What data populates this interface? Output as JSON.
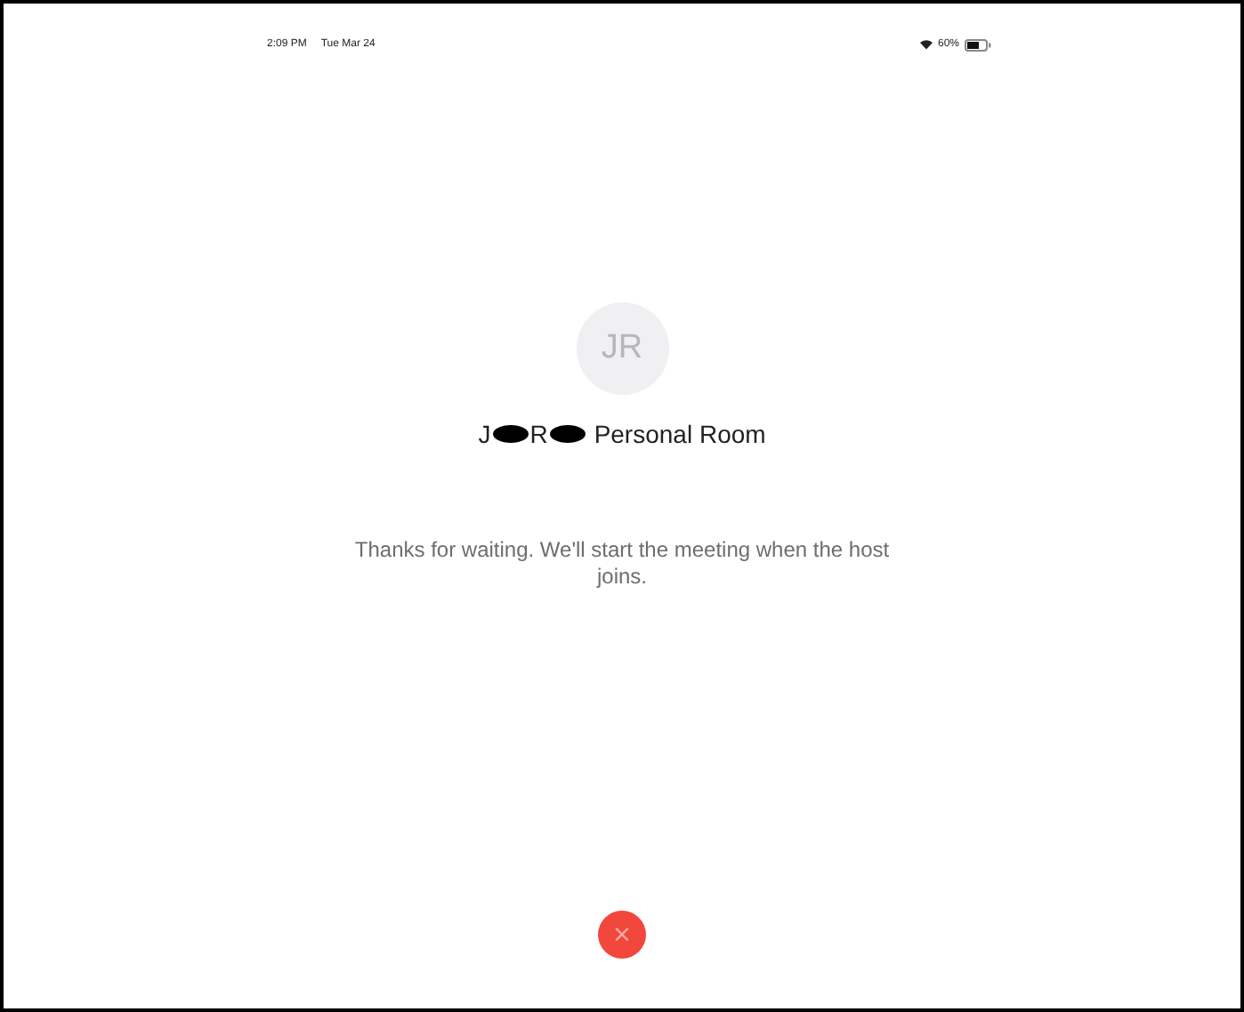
{
  "status_bar": {
    "time": "2:09 PM",
    "date": "Tue Mar 24",
    "battery": "60%"
  },
  "avatar": {
    "initials": "JR"
  },
  "room_title": [
    {
      "kind": "text",
      "text": "J"
    },
    {
      "kind": "redaction"
    },
    {
      "kind": "text",
      "text": "R"
    },
    {
      "kind": "redaction"
    },
    {
      "kind": "text",
      "text": "Personal Room"
    }
  ],
  "message": "Thanks for waiting. We'll start the meeting when the host joins.",
  "close_button": {
    "label": "×"
  }
}
